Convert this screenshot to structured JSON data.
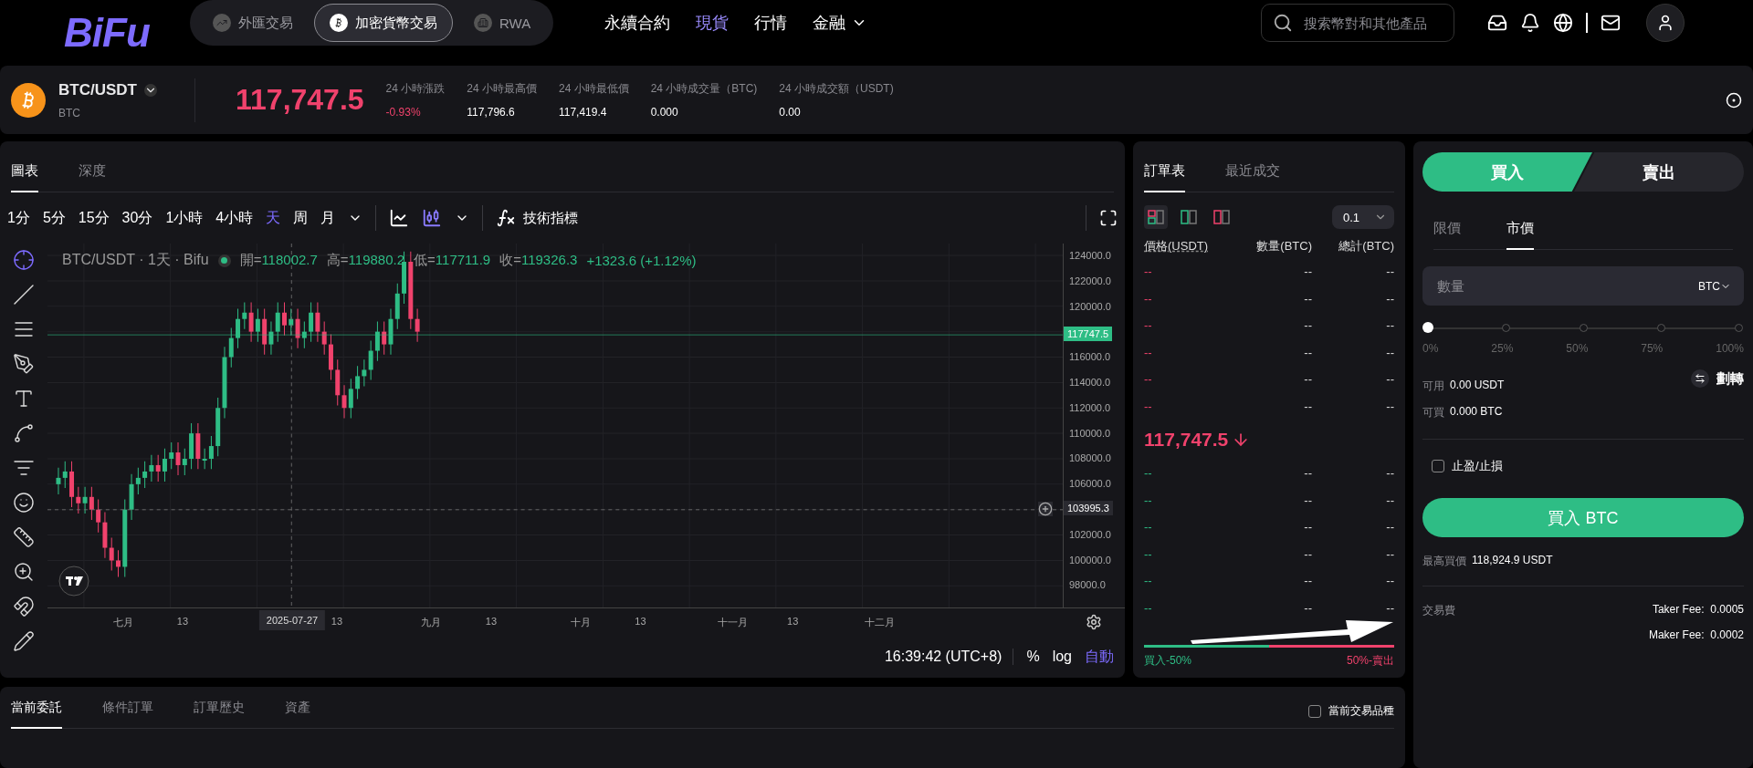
{
  "logo": {
    "text": "BiFu"
  },
  "markets": [
    {
      "label": "外匯交易",
      "kind": "forex",
      "selected": false
    },
    {
      "label": "加密貨幣交易",
      "kind": "crypto",
      "selected": true
    },
    {
      "label": "RWA",
      "kind": "rwa",
      "selected": false
    }
  ],
  "nav": [
    {
      "label": "永續合約",
      "selected": false,
      "has_menu": false
    },
    {
      "label": "現貨",
      "selected": true,
      "has_menu": false
    },
    {
      "label": "行情",
      "selected": false,
      "has_menu": false
    },
    {
      "label": "金融",
      "selected": false,
      "has_menu": true
    }
  ],
  "search": {
    "placeholder": "搜索幣對和其他產品"
  },
  "ticker": {
    "symbol": "BTC/USDT",
    "base": "BTC",
    "price": "117,747.5",
    "stats": [
      {
        "label": "24 小時漲跌",
        "value": "-0.93%",
        "color": "#f0426c"
      },
      {
        "label": "24 小時最高價",
        "value": "117,796.6",
        "color": "#ffffff"
      },
      {
        "label": "24 小時最低價",
        "value": "117,419.4",
        "color": "#ffffff"
      },
      {
        "label": "24 小時成交量（BTC)",
        "value": "0.000",
        "color": "#ffffff"
      },
      {
        "label": "24 小時成交額（USDT)",
        "value": "0.00",
        "color": "#ffffff"
      }
    ]
  },
  "chart_panel": {
    "tabs": [
      {
        "label": "圖表",
        "selected": true
      },
      {
        "label": "深度",
        "selected": false
      }
    ],
    "intervals": [
      {
        "label": "1分",
        "selected": false
      },
      {
        "label": "5分",
        "selected": false
      },
      {
        "label": "15分",
        "selected": false
      },
      {
        "label": "30分",
        "selected": false
      },
      {
        "label": "1小時",
        "selected": false
      },
      {
        "label": "4小時",
        "selected": false
      },
      {
        "label": "天",
        "selected": true
      },
      {
        "label": "周",
        "selected": false
      },
      {
        "label": "月",
        "selected": false
      }
    ],
    "indicators_label": "技術指標",
    "legend": {
      "title": "BTC/USDT · 1天 · Bifu",
      "fields": [
        {
          "label": "開=",
          "value": "118002.7"
        },
        {
          "label": "高=",
          "value": "119880.2"
        },
        {
          "label": "低=",
          "value": "117711.9"
        },
        {
          "label": "收=",
          "value": "119326.3"
        }
      ],
      "change": "+1323.6 (+1.12%)"
    },
    "price_axis": [
      "124000.0",
      "122000.0",
      "120000.0",
      "116000.0",
      "114000.0",
      "112000.0",
      "110000.0",
      "108000.0",
      "106000.0",
      "102000.0",
      "100000.0",
      "98000.0"
    ],
    "last_price_tag": "117747.5",
    "cursor_price_tag": "103995.3",
    "time_axis": [
      "七月",
      "13",
      "13",
      "九月",
      "13",
      "十月",
      "13",
      "十一月",
      "13",
      "十二月"
    ],
    "cursor_date_tag": "2025-07-27",
    "clock": "16:39:42 (UTC+8)",
    "scale_modes": [
      {
        "label": "%",
        "selected": false
      },
      {
        "label": "log",
        "selected": false
      },
      {
        "label": "自動",
        "selected": true
      }
    ]
  },
  "order_book": {
    "tabs": [
      {
        "label": "訂單表",
        "selected": true
      },
      {
        "label": "最近成交",
        "selected": false
      }
    ],
    "views": [
      {
        "kind": "both",
        "selected": true
      },
      {
        "kind": "bids",
        "selected": false
      },
      {
        "kind": "asks",
        "selected": false
      }
    ],
    "precision": "0.1",
    "columns": [
      "價格(USDT)",
      "數量(BTC)",
      "總計(BTC)"
    ],
    "asks": [
      [
        "--",
        "--",
        "--"
      ],
      [
        "--",
        "--",
        "--"
      ],
      [
        "--",
        "--",
        "--"
      ],
      [
        "--",
        "--",
        "--"
      ],
      [
        "--",
        "--",
        "--"
      ],
      [
        "--",
        "--",
        "--"
      ]
    ],
    "last_price": "117,747.5",
    "bids": [
      [
        "--",
        "--",
        "--"
      ],
      [
        "--",
        "--",
        "--"
      ],
      [
        "--",
        "--",
        "--"
      ],
      [
        "--",
        "--",
        "--"
      ],
      [
        "--",
        "--",
        "--"
      ],
      [
        "--",
        "--",
        "--"
      ]
    ],
    "ratio": {
      "level": 0.5,
      "buy_label": "買入-50%",
      "sell_label": "50%-賣出"
    }
  },
  "trade": {
    "sides": [
      {
        "label": "買入",
        "selected": true
      },
      {
        "label": "賣出",
        "selected": false
      }
    ],
    "order_types": [
      {
        "label": "限價",
        "selected": false
      },
      {
        "label": "市價",
        "selected": true
      }
    ],
    "amount": {
      "placeholder": "數量",
      "unit": "BTC"
    },
    "slider": {
      "level": 0,
      "marks": [
        "0%",
        "25%",
        "50%",
        "75%",
        "100%"
      ]
    },
    "balances": [
      {
        "label": "可用",
        "value": "0.00 USDT"
      },
      {
        "label": "可買",
        "value": "0.000 BTC"
      }
    ],
    "transfer": "劃轉",
    "tpsl": {
      "label": "止盈/止損",
      "checked": false
    },
    "submit": "買入 BTC",
    "best_price": {
      "label": "最高買價",
      "value": "118,924.9 USDT"
    },
    "fees": {
      "label": "交易費",
      "rows": [
        {
          "label": "Taker Fee:",
          "value": "0.0005"
        },
        {
          "label": "Maker Fee:",
          "value": "0.0002"
        }
      ]
    }
  },
  "orders_panel": {
    "tabs": [
      {
        "label": "當前委託",
        "selected": true
      },
      {
        "label": "條件訂單",
        "selected": false
      },
      {
        "label": "訂單歷史",
        "selected": false
      },
      {
        "label": "資產",
        "selected": false
      }
    ],
    "filter": {
      "label": "當前交易品種",
      "checked": false
    }
  }
}
